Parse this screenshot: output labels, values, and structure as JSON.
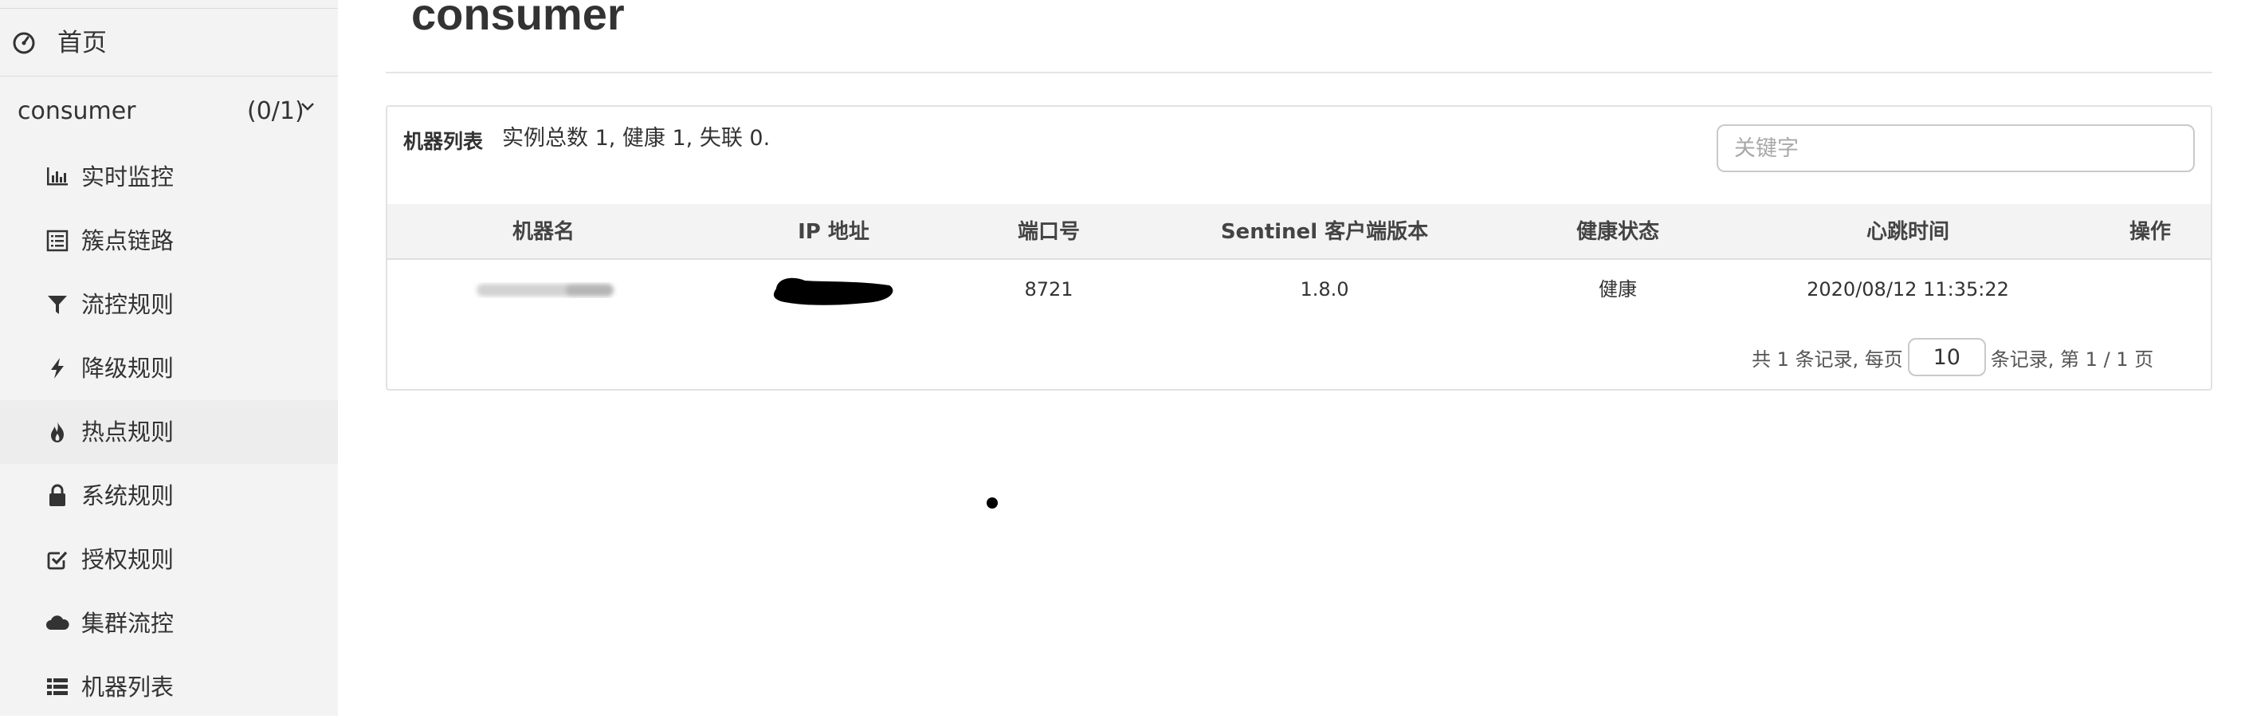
{
  "sidebar": {
    "home_label": "首页",
    "app": {
      "name": "consumer",
      "count": "(0/1)"
    },
    "items": [
      {
        "label": "实时监控",
        "icon": "bar-chart-icon"
      },
      {
        "label": "簇点链路",
        "icon": "list-alt-icon"
      },
      {
        "label": "流控规则",
        "icon": "filter-icon"
      },
      {
        "label": "降级规则",
        "icon": "flash-icon"
      },
      {
        "label": "热点规则",
        "icon": "fire-icon"
      },
      {
        "label": "系统规则",
        "icon": "lock-icon"
      },
      {
        "label": "授权规则",
        "icon": "check-square-icon"
      },
      {
        "label": "集群流控",
        "icon": "cloud-icon"
      },
      {
        "label": "机器列表",
        "icon": "th-list-icon"
      }
    ]
  },
  "main": {
    "title": "consumer",
    "panel": {
      "title": "机器列表",
      "summary": "实例总数 1, 健康 1, 失联 0.",
      "search_placeholder": "关键字",
      "columns": [
        "机器名",
        "IP 地址",
        "端口号",
        "Sentinel 客户端版本",
        "健康状态",
        "心跳时间",
        "操作"
      ],
      "rows": [
        {
          "host": "",
          "ip": "",
          "port": "8721",
          "version": "1.8.0",
          "health": "健康",
          "heartbeat": "2020/08/12 11:35:22",
          "action": ""
        }
      ],
      "pager": {
        "prefix": "共 1 条记录, 每页",
        "page_size": "10",
        "suffix": "条记录, 第 1 / 1 页"
      }
    }
  },
  "colors": {
    "sidebar_bg": "#f3f3f4",
    "header_bg": "#f3f3f4",
    "border": "#e2e2e2",
    "text": "#333333"
  }
}
